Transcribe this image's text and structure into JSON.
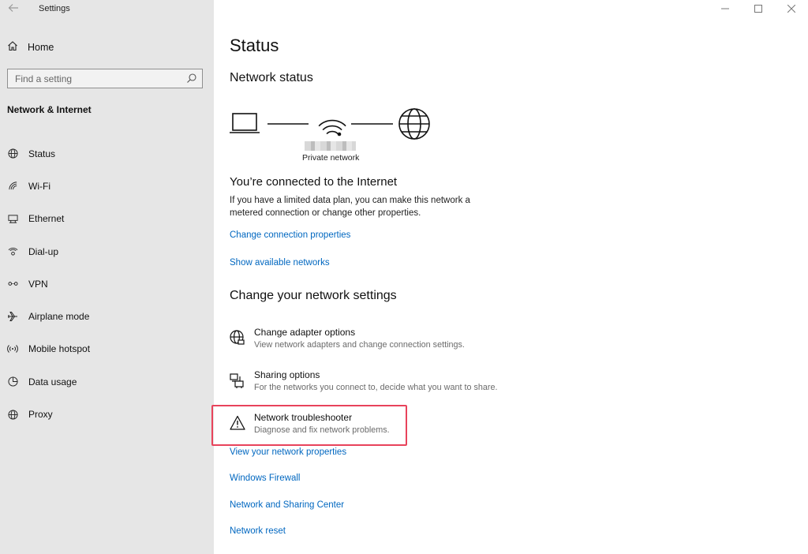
{
  "app": {
    "title": "Settings"
  },
  "sidebar": {
    "home_label": "Home",
    "search_placeholder": "Find a setting",
    "section_title": "Network & Internet",
    "items": [
      {
        "label": "Status",
        "icon": "globe-icon"
      },
      {
        "label": "Wi-Fi",
        "icon": "wifi-icon"
      },
      {
        "label": "Ethernet",
        "icon": "ethernet-icon"
      },
      {
        "label": "Dial-up",
        "icon": "phone-icon"
      },
      {
        "label": "VPN",
        "icon": "vpn-icon"
      },
      {
        "label": "Airplane mode",
        "icon": "airplane-icon"
      },
      {
        "label": "Mobile hotspot",
        "icon": "hotspot-icon"
      },
      {
        "label": "Data usage",
        "icon": "pie-chart-icon"
      },
      {
        "label": "Proxy",
        "icon": "globe-icon"
      }
    ]
  },
  "main": {
    "page_title": "Status",
    "network_status_heading": "Network status",
    "network_type": "Private network",
    "connected_title": "You’re connected to the Internet",
    "connected_desc": "If you have a limited data plan, you can make this network a metered connection or change other properties.",
    "links_top": [
      "Change connection properties",
      "Show available networks"
    ],
    "change_heading": "Change your network settings",
    "options": [
      {
        "title": "Change adapter options",
        "desc": "View network adapters and change connection settings.",
        "icon": "adapter-globe-icon"
      },
      {
        "title": "Sharing options",
        "desc": "For the networks you connect to, decide what you want to share.",
        "icon": "sharing-icon"
      },
      {
        "title": "Network troubleshooter",
        "desc": "Diagnose and fix network problems.",
        "icon": "warning-icon",
        "highlighted": true
      }
    ],
    "links_bottom": [
      "View your network properties",
      "Windows Firewall",
      "Network and Sharing Center",
      "Network reset"
    ]
  },
  "colors": {
    "link": "#0067c0",
    "sidebar_bg": "#e6e6e6",
    "highlight": "#e8435b"
  }
}
